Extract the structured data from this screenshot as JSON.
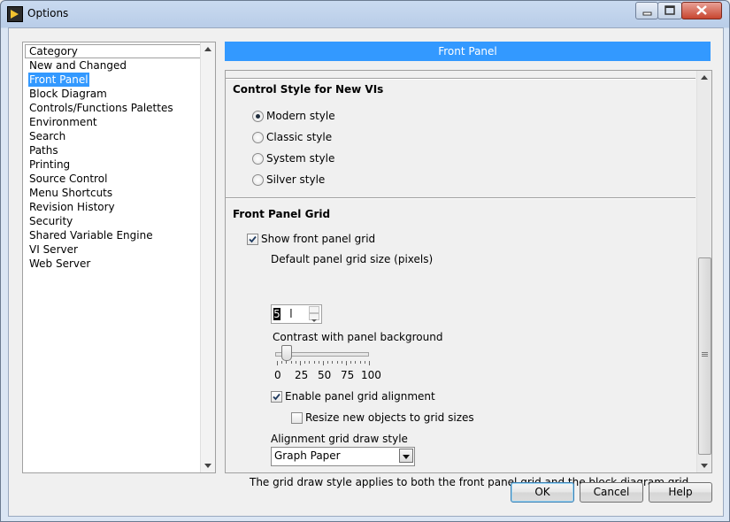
{
  "window": {
    "title": "Options"
  },
  "category": {
    "header": "Category",
    "items": [
      "New and Changed",
      "Front Panel",
      "Block Diagram",
      "Controls/Functions Palettes",
      "Environment",
      "Search",
      "Paths",
      "Printing",
      "Source Control",
      "Menu Shortcuts",
      "Revision History",
      "Security",
      "Shared Variable Engine",
      "VI Server",
      "Web Server"
    ],
    "selected": "Front Panel"
  },
  "panel": {
    "header": "Front Panel",
    "control_style": {
      "heading": "Control Style for New VIs",
      "options": [
        "Modern style",
        "Classic style",
        "System style",
        "Silver style"
      ],
      "selected": "Modern style"
    },
    "grid": {
      "heading": "Front Panel Grid",
      "show_grid_label": "Show front panel grid",
      "show_grid_checked": true,
      "size_label": "Default panel grid size (pixels)",
      "size_value": "5",
      "contrast_label": "Contrast with panel background",
      "contrast_ticks": [
        "0",
        "25",
        "50",
        "75",
        "100"
      ],
      "contrast_value": 10,
      "alignment_label": "Enable panel grid alignment",
      "alignment_checked": true,
      "resize_label": "Resize new objects to grid sizes",
      "resize_checked": false,
      "draw_style_label": "Alignment grid draw style",
      "draw_style_value": "Graph Paper",
      "note": "The grid draw style applies to both the front panel grid and the block diagram grid."
    }
  },
  "buttons": {
    "ok": "OK",
    "cancel": "Cancel",
    "help": "Help"
  },
  "colors": {
    "selection": "#3399ff",
    "header_bg": "#3399ff"
  }
}
